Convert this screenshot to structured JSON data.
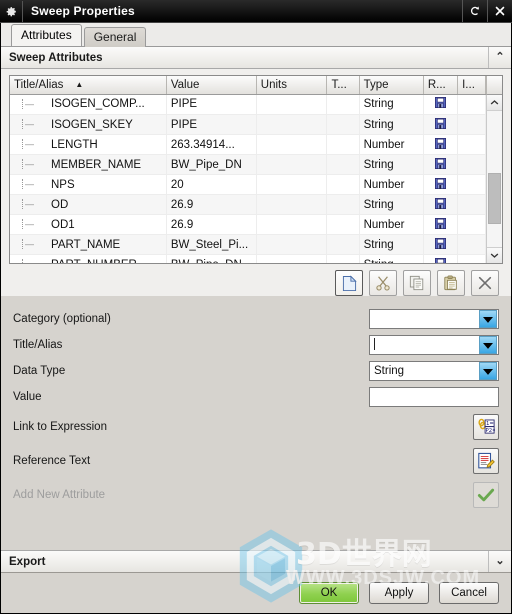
{
  "window": {
    "title": "Sweep Properties",
    "app_icon": "gear-icon",
    "restore_label": "↺",
    "close_label": "✕"
  },
  "tabs": [
    {
      "label": "Attributes",
      "active": true
    },
    {
      "label": "General",
      "active": false
    }
  ],
  "section": {
    "title": "Sweep Attributes",
    "collapse_caret": "⌃"
  },
  "table": {
    "columns": [
      "Title/Alias",
      "Value",
      "Units",
      "T...",
      "Type",
      "R...",
      "I...",
      ""
    ],
    "sort_column": "Title/Alias",
    "sort_arrow": "▲",
    "rows": [
      {
        "title": "ISOGEN_COMP...",
        "value": "PIPE",
        "units": "",
        "t": "",
        "type": "String",
        "r": "save-icon",
        "i": ""
      },
      {
        "title": "ISOGEN_SKEY",
        "value": "PIPE",
        "units": "",
        "t": "",
        "type": "String",
        "r": "save-icon",
        "i": ""
      },
      {
        "title": "LENGTH",
        "value": "263.34914...",
        "units": "",
        "t": "",
        "type": "Number",
        "r": "save-icon",
        "i": ""
      },
      {
        "title": "MEMBER_NAME",
        "value": "BW_Pipe_DN",
        "units": "",
        "t": "",
        "type": "String",
        "r": "save-icon",
        "i": ""
      },
      {
        "title": "NPS",
        "value": "20",
        "units": "",
        "t": "",
        "type": "Number",
        "r": "save-icon",
        "i": ""
      },
      {
        "title": "OD",
        "value": "26.9",
        "units": "",
        "t": "",
        "type": "String",
        "r": "save-icon",
        "i": ""
      },
      {
        "title": "OD1",
        "value": "26.9",
        "units": "",
        "t": "",
        "type": "Number",
        "r": "save-icon",
        "i": ""
      },
      {
        "title": "PART_NAME",
        "value": "BW_Steel_Pi...",
        "units": "",
        "t": "",
        "type": "String",
        "r": "save-icon",
        "i": ""
      },
      {
        "title": "PART_NUMBER",
        "value": "BW_Pipe_DN",
        "units": "",
        "t": "",
        "type": "String",
        "r": "save-icon",
        "i": ""
      }
    ],
    "scroll_up": "⌃",
    "scroll_down": "⌄"
  },
  "toolbar": [
    {
      "name": "new-attribute-button",
      "icon": "page-icon",
      "selected": true
    },
    {
      "name": "cut-button",
      "icon": "scissors-icon",
      "selected": false
    },
    {
      "name": "copy-button",
      "icon": "copy-icon",
      "selected": false
    },
    {
      "name": "paste-button",
      "icon": "clipboard-icon",
      "selected": false
    },
    {
      "name": "delete-button",
      "icon": "x-icon",
      "selected": false
    }
  ],
  "form": {
    "category": {
      "label": "Category (optional)",
      "value": ""
    },
    "title_alias": {
      "label": "Title/Alias",
      "value": ""
    },
    "data_type": {
      "label": "Data Type",
      "value": "String"
    },
    "value": {
      "label": "Value",
      "value": ""
    },
    "link_to_expression": {
      "label": "Link to Expression",
      "icon": "link-expression-icon"
    },
    "reference_text": {
      "label": "Reference Text",
      "icon": "edit-document-icon"
    },
    "add_new_attribute": {
      "label": "Add New Attribute",
      "icon": "check-icon",
      "enabled": false
    }
  },
  "export": {
    "title": "Export",
    "collapse_caret": "⌄"
  },
  "footer": {
    "ok": "OK",
    "apply": "Apply",
    "cancel": "Cancel"
  },
  "watermark": {
    "text": "3D世界网",
    "url": "WWW.3DSJW.COM"
  },
  "colors": {
    "titlebar": "#000000",
    "panel": "#d6d3ce",
    "accent_dropdown": "#39a6e4",
    "ok_green": "#8fd14f",
    "save_icon_blue": "#3b4fa0"
  }
}
